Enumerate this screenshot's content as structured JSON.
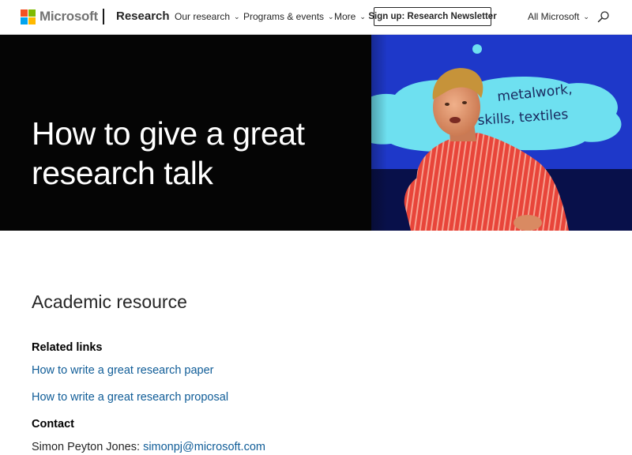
{
  "header": {
    "logo_text": "Microsoft",
    "logo_colors": [
      "#f25022",
      "#7fba00",
      "#00a4ef",
      "#ffb900"
    ],
    "brand": "Research",
    "nav": [
      {
        "label": "Our research",
        "icon": "chevron-down-icon"
      },
      {
        "label": "Programs & events",
        "icon": "chevron-down-icon"
      },
      {
        "label": "More",
        "icon": "chevron-down-icon"
      }
    ],
    "signup_label": "Sign up: Research Newsletter",
    "all_microsoft": "All Microsoft",
    "search_icon": "search-icon"
  },
  "hero": {
    "title_line1": "How to give a great",
    "title_line2": "research talk",
    "slide_text_line1": "metalwork,",
    "slide_text_line2": "skills, textiles"
  },
  "content": {
    "section_title": "Academic resource",
    "related_links_heading": "Related links",
    "related_links": [
      "How to write a great research paper",
      "How to write a great research proposal"
    ],
    "contact_heading": "Contact",
    "contact_name": "Simon Peyton Jones: ",
    "contact_email": "simonpj@microsoft.com"
  },
  "colors": {
    "link": "#0f5c97",
    "hero_background": "#050505",
    "slide_blue": "#1e38c9",
    "cloud": "#6ee0f0"
  }
}
